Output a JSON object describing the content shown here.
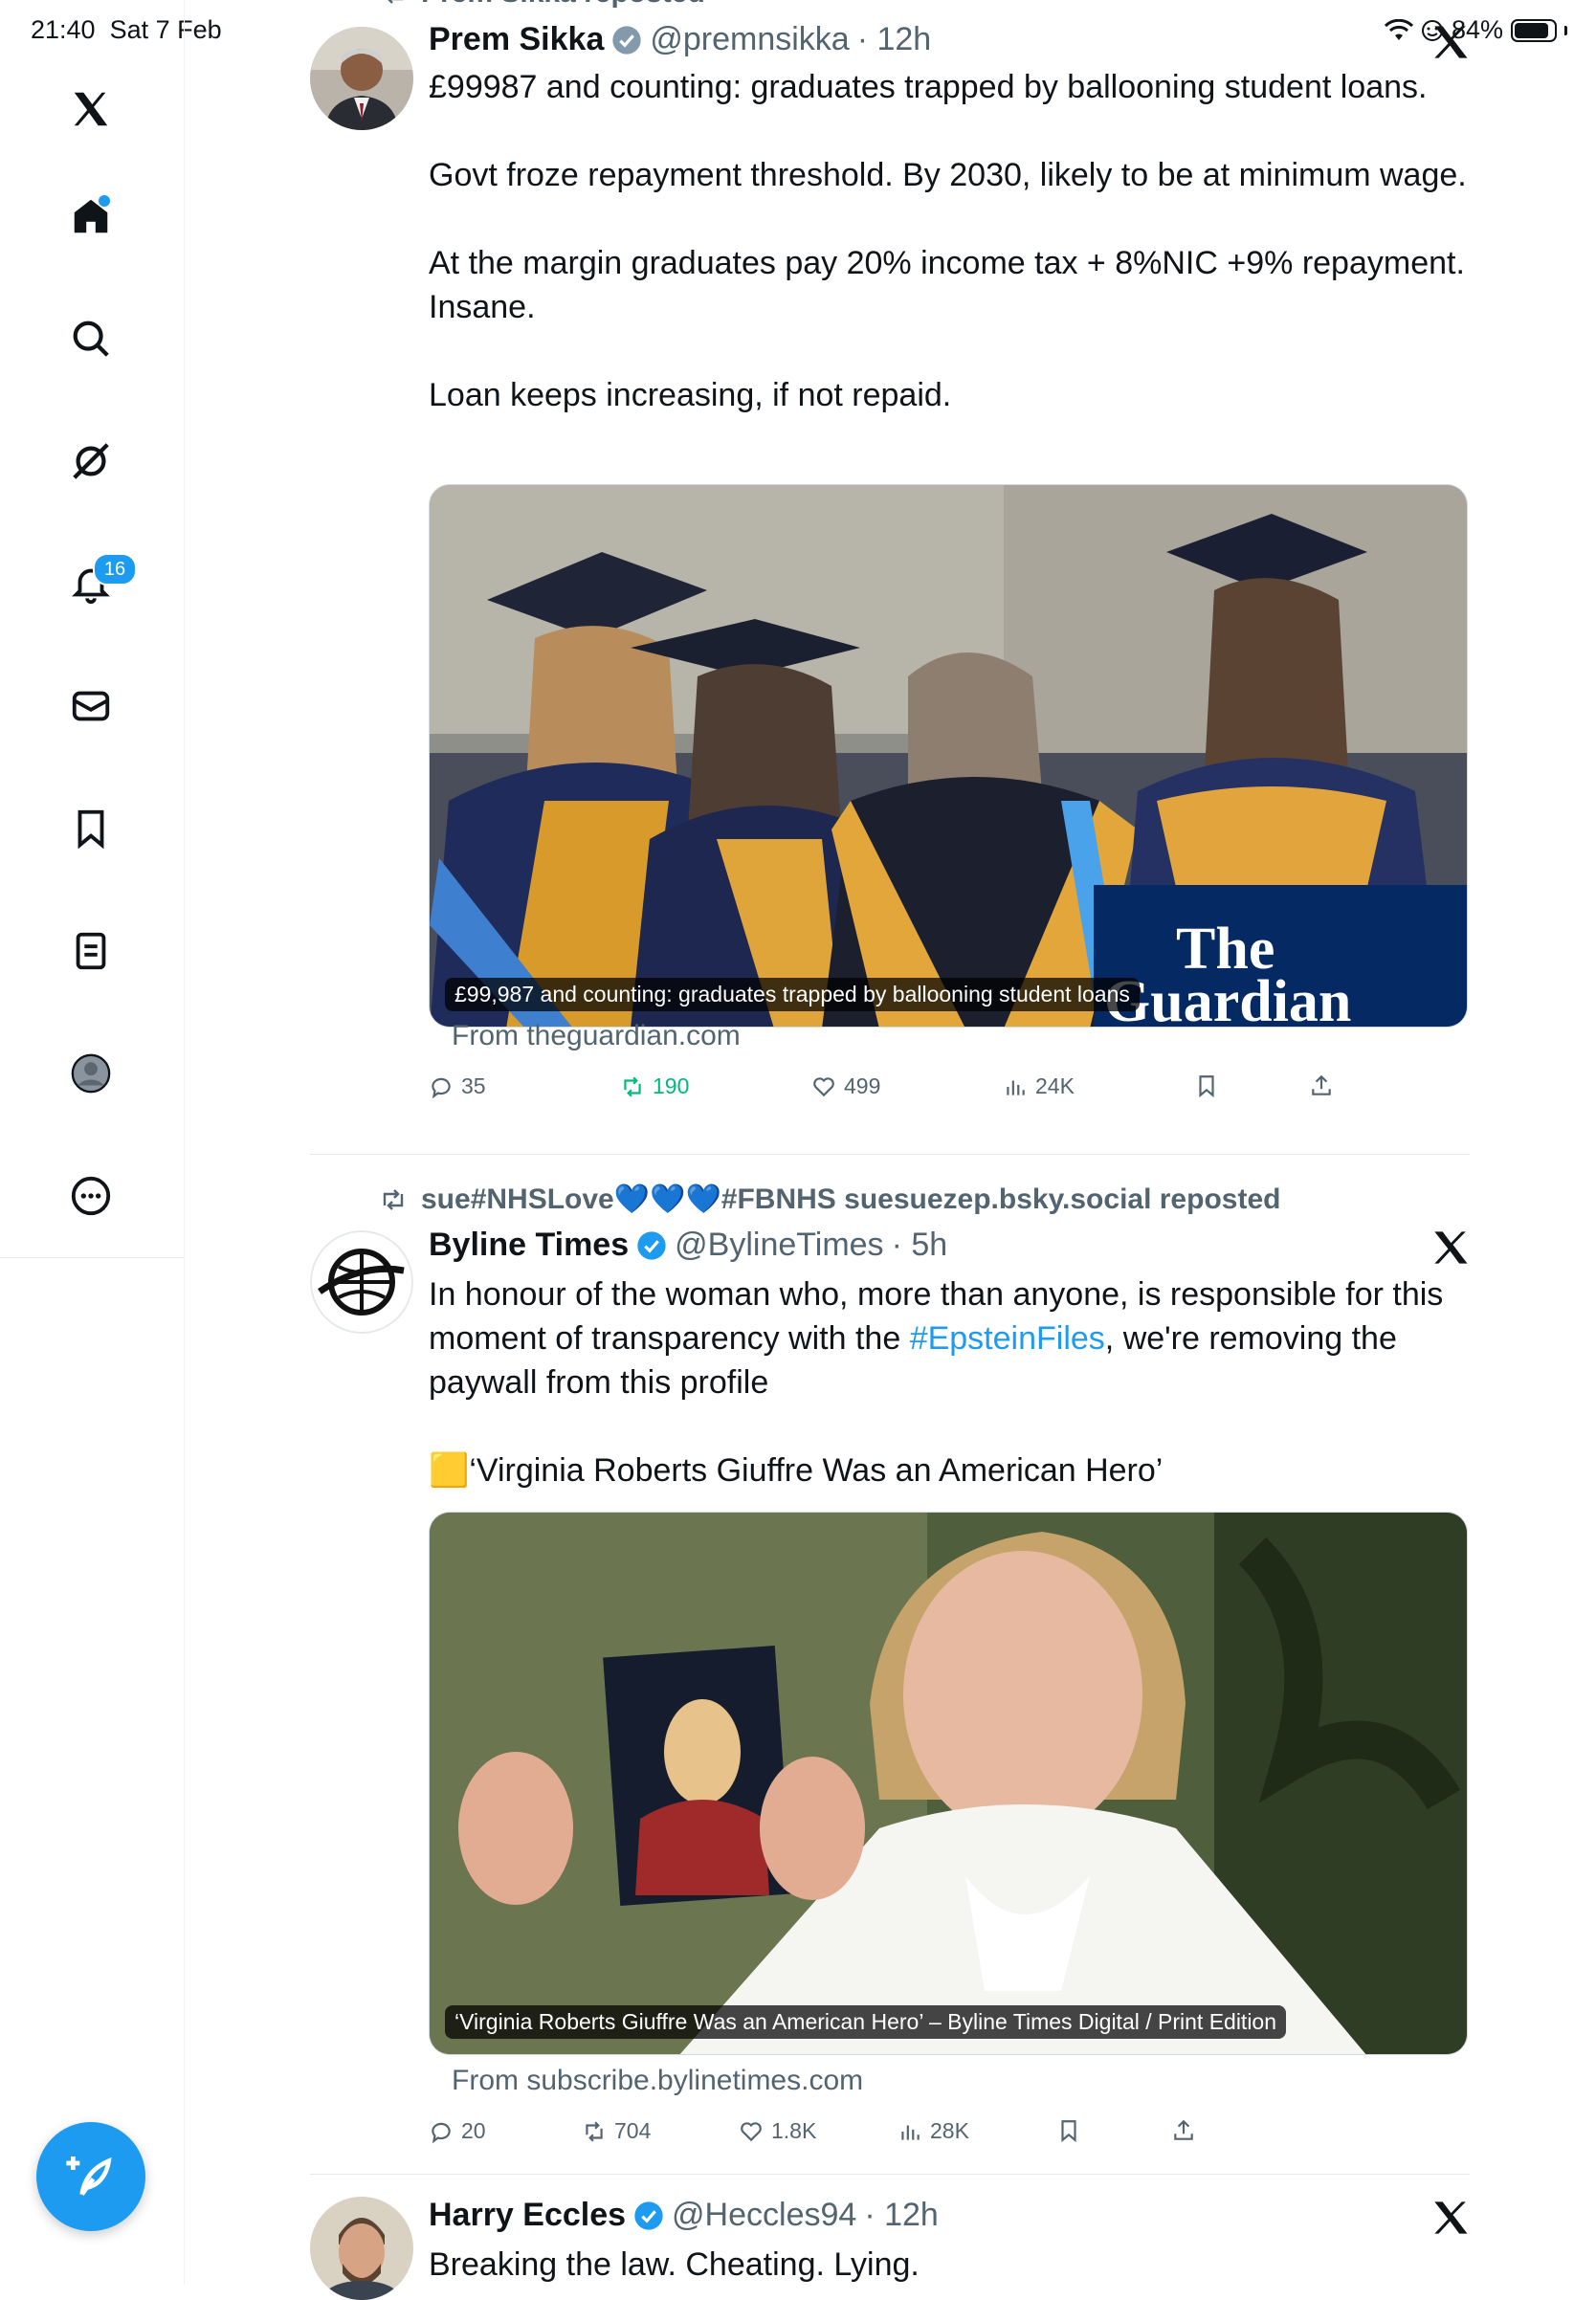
{
  "status": {
    "time": "21:40",
    "date": "Sat 7 Feb",
    "battery": "84%"
  },
  "sidebar": {
    "items": [
      {
        "label": "X",
        "icon": "x-logo-icon"
      },
      {
        "label": "Home",
        "icon": "home-icon",
        "active": true
      },
      {
        "label": "Search",
        "icon": "search-icon"
      },
      {
        "label": "Grok",
        "icon": "grok-icon"
      },
      {
        "label": "Notifications",
        "icon": "bell-icon",
        "badge": "16"
      },
      {
        "label": "Messages",
        "icon": "mail-icon"
      },
      {
        "label": "Bookmarks",
        "icon": "bookmark-icon"
      },
      {
        "label": "Lists",
        "icon": "list-icon"
      },
      {
        "label": "Profile",
        "icon": "avatar-icon"
      },
      {
        "label": "More",
        "icon": "more-icon"
      }
    ],
    "compose_icon": "feather-plus-icon"
  },
  "tweets": [
    {
      "repost_by": "Prem Sikka reposted",
      "name": "Prem Sikka",
      "handle": "@premnsikka",
      "time": "· 12h",
      "paragraphs": [
        "£99987 and counting: graduates trapped by ballooning student loans.",
        "Govt froze repayment threshold. By 2030, likely to be at minimum wage.",
        "At the margin graduates pay 20% income tax + 8%NIC +9% repayment. Insane.",
        "Loan keeps increasing, if not repaid."
      ],
      "media_caption": "£99,987 and counting: graduates trapped by ballooning student loans",
      "media_brand": "The Guardian",
      "from": "From theguardian.com",
      "stats": {
        "replies": "35",
        "reposts": "190",
        "likes": "499",
        "views": "24K"
      }
    },
    {
      "repost_by": "sue#NHSLove💙💙💙#FBNHS suesuezep.bsky.social reposted",
      "name": "Byline Times",
      "handle": "@BylineTimes",
      "time": "· 5h",
      "text_before": "In honour of the woman who, more than anyone, is responsible for this moment of transparency with the ",
      "hashtag": "#EpsteinFiles",
      "text_after": ", we're removing the paywall from this profile",
      "headline": "🟨‘Virginia Roberts Giuffre Was an American Hero’",
      "media_caption": "‘Virginia Roberts Giuffre Was an American Hero’ – Byline Times Digital / Print Edition",
      "from": "From subscribe.bylinetimes.com",
      "stats": {
        "replies": "20",
        "reposts": "704",
        "likes": "1.8K",
        "views": "28K"
      }
    },
    {
      "name": "Harry Eccles",
      "handle": "@Heccles94",
      "time": "· 12h",
      "text": "Breaking the law. Cheating. Lying."
    }
  ],
  "colors": {
    "accent": "#1d9bf0",
    "repost_green": "#00ba7c",
    "muted": "#536471"
  }
}
